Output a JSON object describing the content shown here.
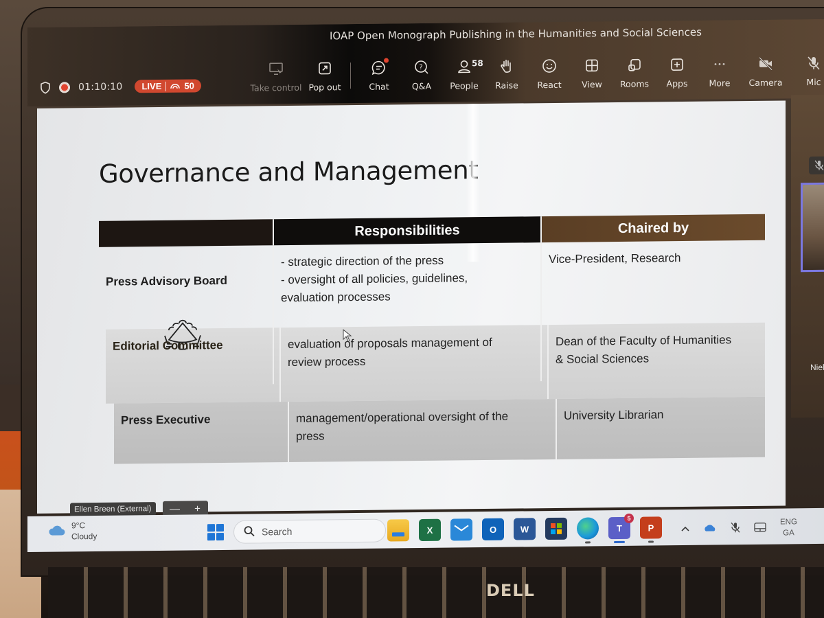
{
  "meeting": {
    "title": "IOAP Open Monograph Publishing in the Humanities and Social Sciences",
    "timer": "01:10:10",
    "live_label": "LIVE",
    "viewer_count": "50"
  },
  "toolbar": {
    "items": [
      {
        "label": "Take control",
        "icon": "take-control-icon",
        "enabled": false
      },
      {
        "label": "Pop out",
        "icon": "pop-out-icon",
        "enabled": true
      },
      {
        "label": "Chat",
        "icon": "chat-icon",
        "notification": true
      },
      {
        "label": "Q&A",
        "icon": "qa-icon"
      },
      {
        "label": "People",
        "icon": "people-icon",
        "count": "58"
      },
      {
        "label": "Raise",
        "icon": "raise-hand-icon"
      },
      {
        "label": "React",
        "icon": "react-icon"
      },
      {
        "label": "View",
        "icon": "view-icon"
      },
      {
        "label": "Rooms",
        "icon": "rooms-icon"
      },
      {
        "label": "Apps",
        "icon": "apps-icon"
      },
      {
        "label": "More",
        "icon": "more-icon"
      }
    ],
    "media": [
      {
        "label": "Camera",
        "icon": "camera-off-icon",
        "state": "off"
      },
      {
        "label": "Mic",
        "icon": "mic-off-icon",
        "state": "muted"
      }
    ]
  },
  "slide": {
    "title": "Governance and Management",
    "table": {
      "headers": [
        "",
        "Responsibilities",
        "Chaired by"
      ],
      "rows": [
        {
          "body": "Press Advisory Board",
          "responsibilities": "- strategic direction of the press\n- oversight of all policies, guidelines,\nevaluation processes",
          "chaired_by": "Vice-President, Research"
        },
        {
          "body": "Editorial Committee",
          "responsibilities": "evaluation of proposals  management of\nreview process",
          "chaired_by": "Dean of the Faculty of Humanities\n& Social Sciences"
        },
        {
          "body": "Press Executive",
          "responsibilities": "management/operational oversight of the\npress",
          "chaired_by": "University Librarian"
        }
      ]
    }
  },
  "presenter": {
    "name": "Ellen Breen (External)",
    "zoom_out": "—",
    "zoom_in": "+"
  },
  "participants": {
    "visible_name": "Niel"
  },
  "taskbar": {
    "weather_temp": "9°C",
    "weather_desc": "Cloudy",
    "search_placeholder": "Search",
    "apps": [
      {
        "name": "File Explorer",
        "glyph": ""
      },
      {
        "name": "Excel",
        "glyph": "X"
      },
      {
        "name": "Mail",
        "glyph": ""
      },
      {
        "name": "Outlook",
        "glyph": "O"
      },
      {
        "name": "Word",
        "glyph": "W"
      },
      {
        "name": "Microsoft Store",
        "glyph": ""
      },
      {
        "name": "Edge",
        "glyph": ""
      },
      {
        "name": "Teams",
        "glyph": "T",
        "badge": "5"
      },
      {
        "name": "PowerPoint",
        "glyph": "P"
      }
    ],
    "tray": {
      "lang_line1": "ENG",
      "lang_line2": "GA"
    }
  },
  "hardware": {
    "brand": "DELL"
  },
  "colors": {
    "live_red": "#d1482f",
    "header_brown": "#6b4b2c",
    "active_speaker": "#7b78e0",
    "teams_badge": "#c4314b"
  }
}
